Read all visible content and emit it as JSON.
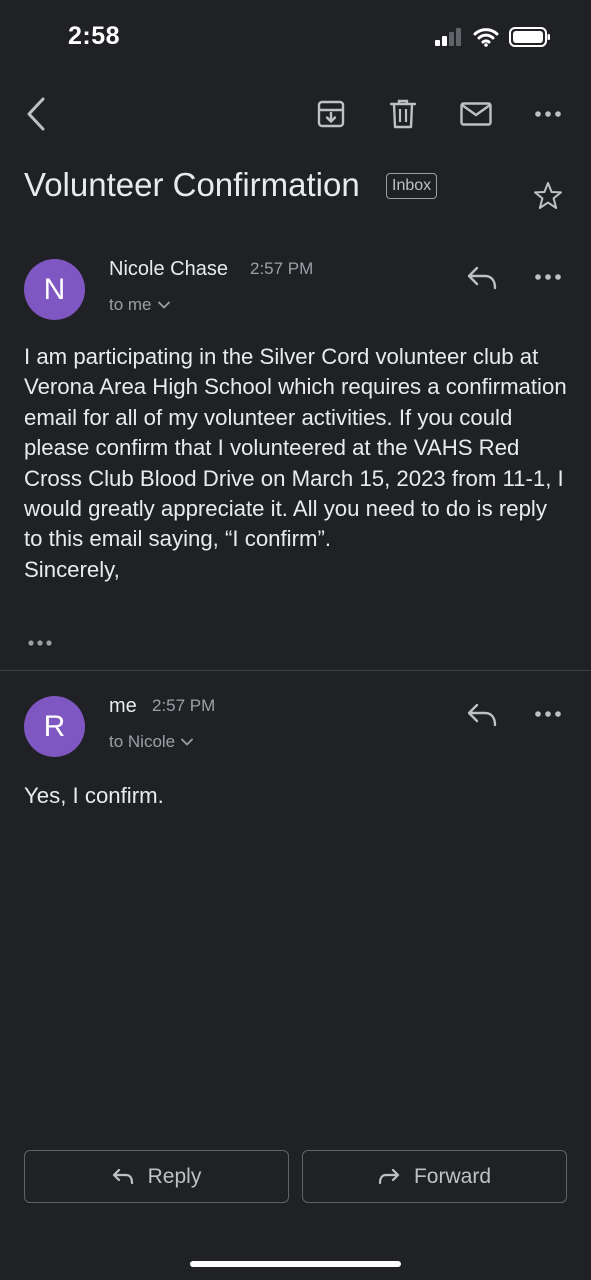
{
  "status_bar": {
    "time": "2:58"
  },
  "email": {
    "subject": "Volunteer Confirmation",
    "label": "Inbox",
    "messages": [
      {
        "avatar_letter": "N",
        "sender": "Nicole Chase",
        "time": "2:57 PM",
        "recipient": "to me",
        "body": " I am participating in the Silver Cord volunteer club at Verona Area High School which requires a confirmation email for all of my volunteer activities. If you could please confirm that I volunteered at the VAHS Red Cross Club Blood Drive on March 15, 2023 from 11-1, I would greatly appreciate it. All you need to do is reply to this email saying, “I confirm”.\nSincerely,"
      },
      {
        "avatar_letter": "R",
        "sender": "me",
        "time": "2:57 PM",
        "recipient": "to Nicole",
        "body": "Yes, I confirm."
      }
    ]
  },
  "actions": {
    "reply_label": "Reply",
    "forward_label": "Forward"
  },
  "icons": {
    "back": "chevron-left-icon",
    "archive": "archive-icon",
    "delete": "trash-icon",
    "mark_unread": "mail-icon",
    "more": "more-horizontal-icon",
    "star": "star-icon",
    "reply": "reply-icon",
    "forward": "forward-icon"
  },
  "colors": {
    "background": "#202124",
    "avatar": "#7e57c2",
    "text": "#e8eaed",
    "muted": "#9aa0a6"
  }
}
